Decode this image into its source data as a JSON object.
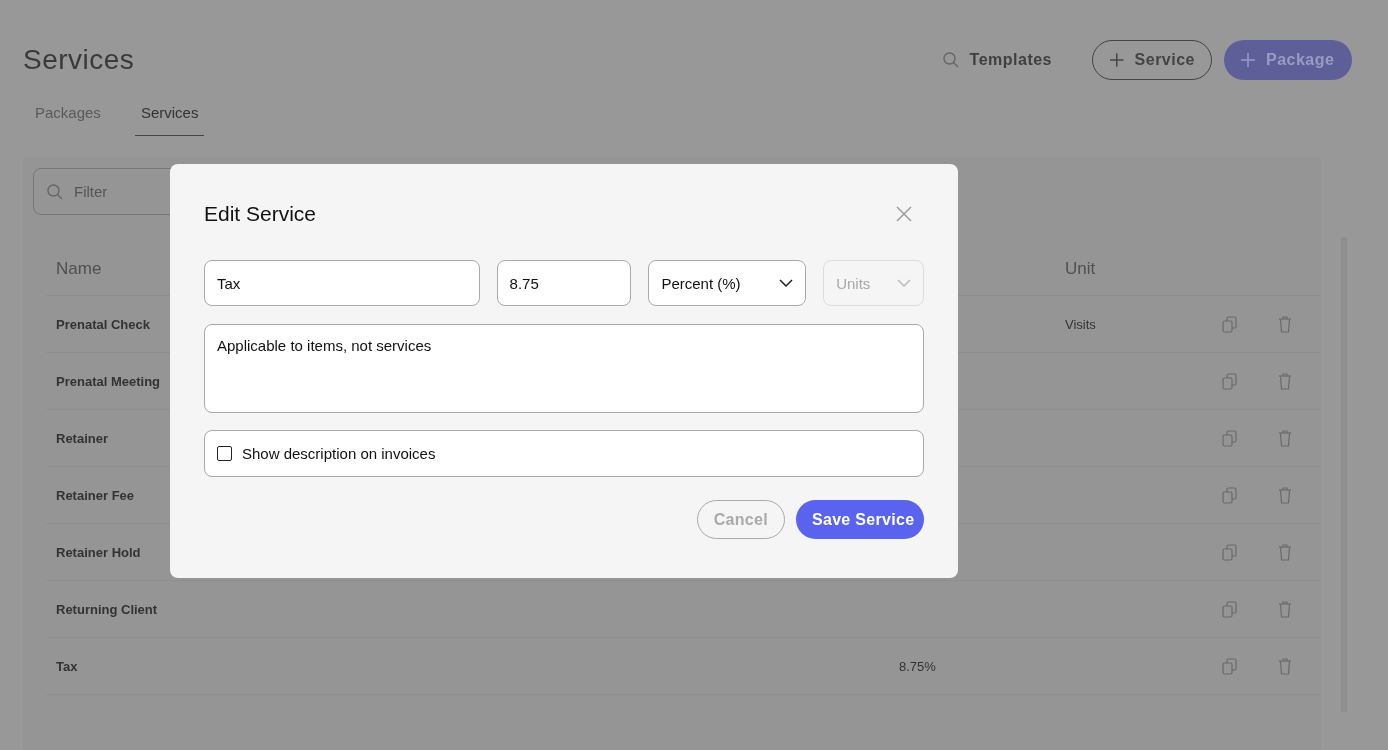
{
  "page": {
    "title": "Services"
  },
  "header_actions": [
    {
      "kind": "link",
      "label": "Templates"
    },
    {
      "kind": "outline",
      "label": "Service"
    },
    {
      "kind": "primary",
      "label": "Package"
    }
  ],
  "tabs": [
    {
      "label": "Packages",
      "selected": false
    },
    {
      "label": "Services",
      "selected": true
    }
  ],
  "filter": {
    "placeholder": "Filter"
  },
  "table": {
    "columns": [
      "Name",
      "Unit"
    ],
    "rows": [
      {
        "name": "Prenatal Check",
        "amount": "",
        "unit": "Visits"
      },
      {
        "name": "Prenatal Meeting",
        "amount": "",
        "unit": ""
      },
      {
        "name": "Retainer",
        "amount": "",
        "unit": ""
      },
      {
        "name": "Retainer Fee",
        "amount": "",
        "unit": ""
      },
      {
        "name": "Retainer Hold",
        "amount": "",
        "unit": ""
      },
      {
        "name": "Returning Client",
        "amount": "",
        "unit": ""
      },
      {
        "name": "Tax",
        "amount": "8.75%",
        "unit": ""
      }
    ]
  },
  "dialog": {
    "title": "Edit Service",
    "name": "Tax",
    "amount": "8.75",
    "type": "Percent (%)",
    "units": {
      "placeholder": "Units",
      "disabled": true
    },
    "description": "Applicable to items, not services",
    "show_description": {
      "label": "Show description on invoices",
      "checked": false
    },
    "buttons": [
      {
        "label": "Cancel",
        "kind": "secondary",
        "disabled": true
      },
      {
        "label": "Save Service",
        "kind": "primary",
        "disabled": false
      }
    ]
  }
}
